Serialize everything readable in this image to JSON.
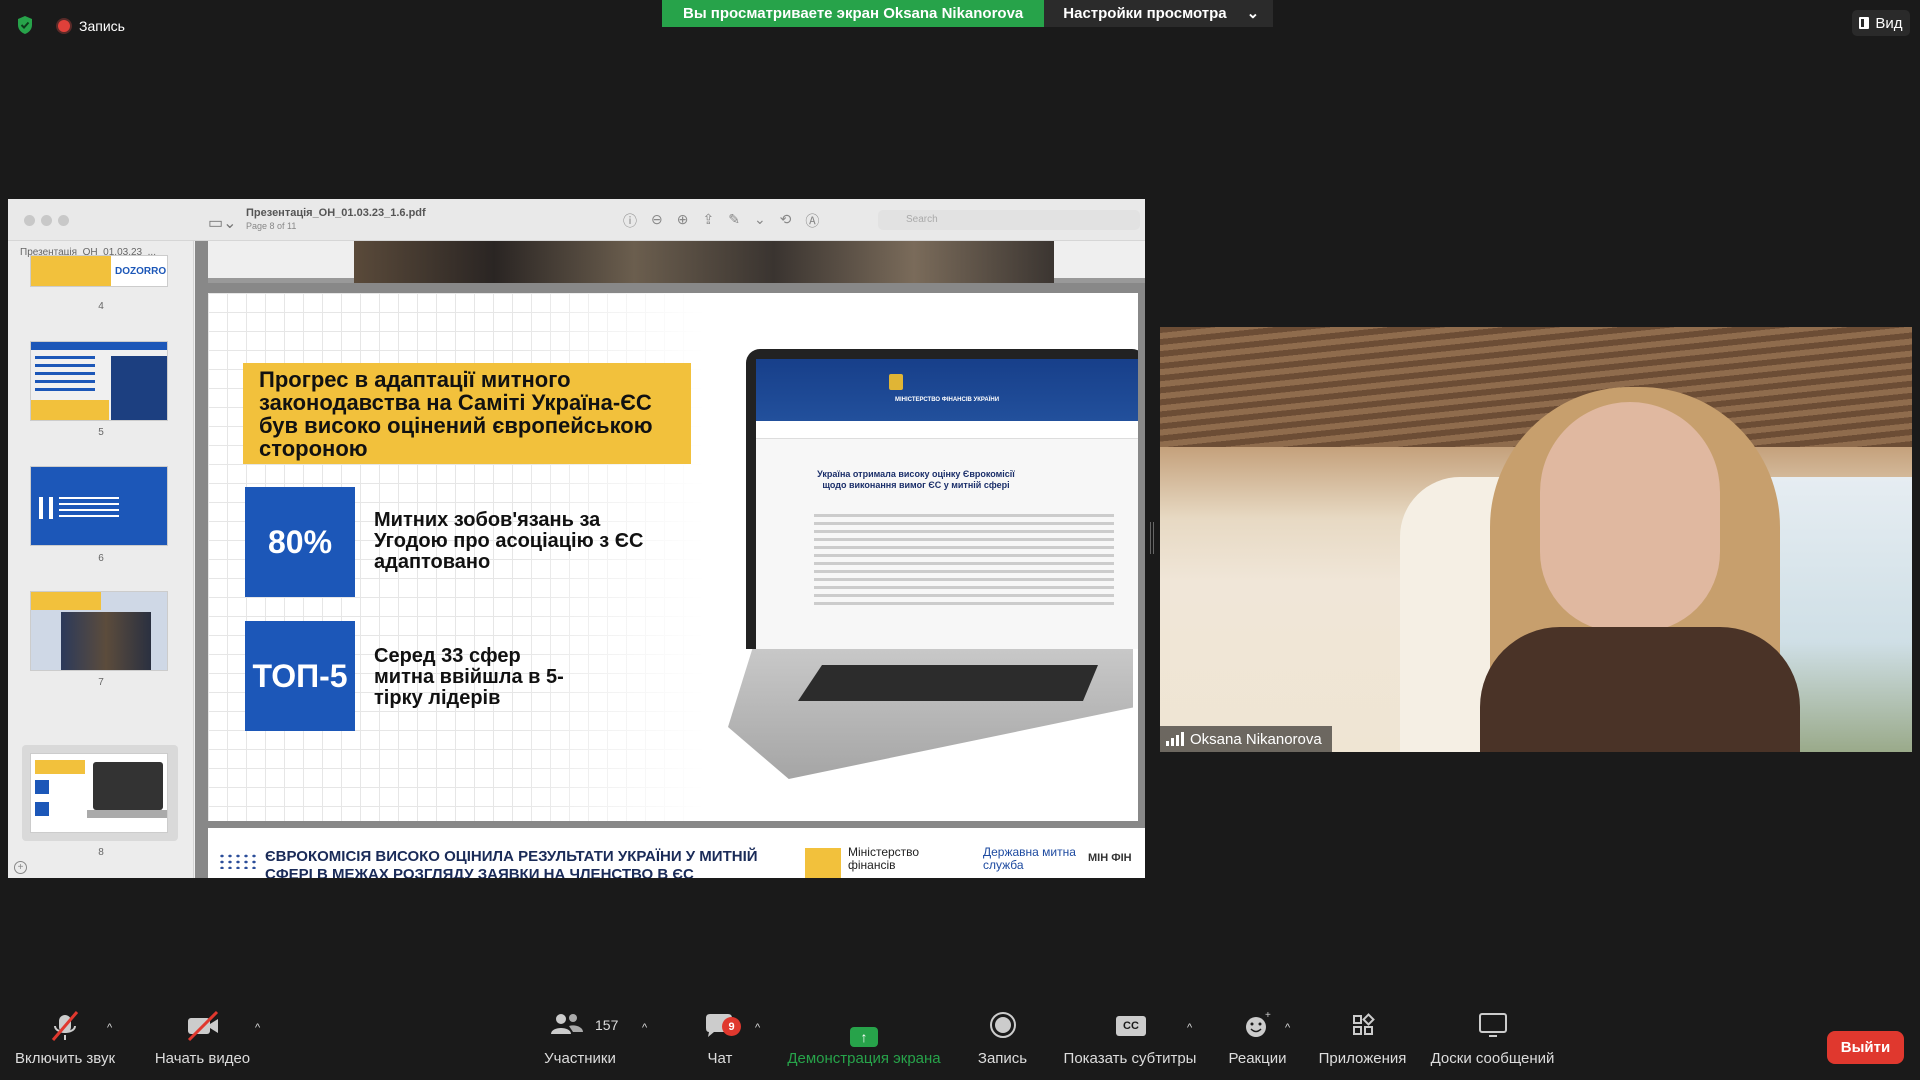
{
  "top": {
    "recording_label": "Запись",
    "banner_text": "Вы просматриваете экран Oksana Nikanorova",
    "view_options_label": "Настройки просмотра",
    "view_button_label": "Вид"
  },
  "viewer": {
    "file_title": "Презентація_ОН_01.03.23_1.6.pdf",
    "page_indicator": "Page 8 of 11",
    "search_placeholder": "Search",
    "sidebar_title": "Презентація_ОН_01.03.23_...",
    "thumbnails": [
      {
        "num": "4",
        "logo": "DOZORRO"
      },
      {
        "num": "5"
      },
      {
        "num": "6"
      },
      {
        "num": "7"
      },
      {
        "num": "8"
      }
    ]
  },
  "slide": {
    "headline": "Прогрес в адаптації митного законодавства на Саміті Україна-ЄС був високо оцінений європейською стороною",
    "stat1_value": "80%",
    "stat1_text": "Митних зобов'язань за Угодою про асоціацію з ЄС адаптовано",
    "stat2_value": "ТОП-5",
    "stat2_text": "Серед 33 сфер митна ввійшла в 5-тірку лідерів",
    "site_title": "МІНІСТЕРСТВО ФІНАНСІВ УКРАЇНИ",
    "site_headline": "Україна отримала високу оцінку Єврокомісії щодо виконання вимог ЄС у митній сфері"
  },
  "next_page": {
    "headline": "ЄВРОКОМІСІЯ ВИСОКО ОЦІНИЛА РЕЗУЛЬТАТИ УКРАЇНИ У МИТНІЙ СФЕРІ В МЕЖАХ РОЗГЛЯДУ ЗАЯВКИ НА ЧЛЕНСТВО В ЄС",
    "logo1_text": "Міністерство фінансів",
    "logo2_text": "Державна митна служба",
    "logo3_text": "МІН ФІН"
  },
  "camera": {
    "participant_name": "Oksana Nikanorova"
  },
  "toolbar": {
    "mute_label": "Включить звук",
    "video_label": "Начать видео",
    "participants_label": "Участники",
    "participants_count": "157",
    "chat_label": "Чат",
    "chat_badge": "9",
    "share_label": "Демонстрация экрана",
    "record_label": "Запись",
    "captions_label": "Показать субтитры",
    "reactions_label": "Реакции",
    "apps_label": "Приложения",
    "whiteboards_label": "Доски сообщений",
    "leave_label": "Выйти"
  },
  "colors": {
    "banner_green": "#27a34a",
    "leave_red": "#e0382e",
    "slide_yellow": "#f2c13c",
    "slide_blue": "#1c57b8"
  },
  "icons": [
    "shield-icon",
    "record-dot-icon",
    "view-icon",
    "chevron-down-icon",
    "mic-muted-icon",
    "video-muted-icon",
    "participants-icon",
    "chat-icon",
    "share-screen-icon",
    "record-icon",
    "cc-icon",
    "reactions-icon",
    "apps-icon",
    "whiteboard-icon",
    "signal-bars-icon"
  ]
}
